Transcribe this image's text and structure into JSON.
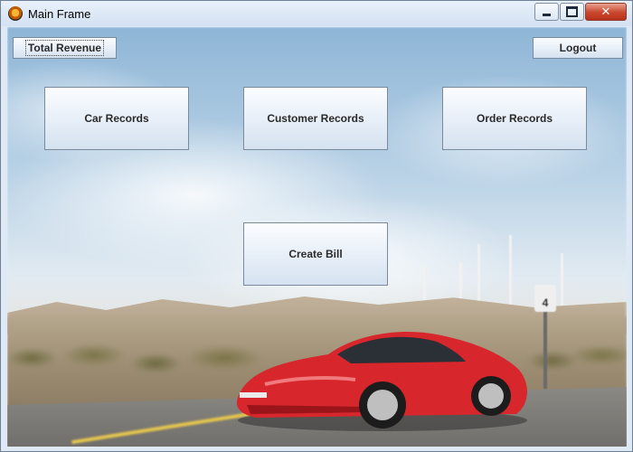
{
  "window": {
    "title": "Main Frame",
    "icon": "app-icon",
    "controls": {
      "minimize": "minimize-icon",
      "maximize": "maximize-icon",
      "close": "close-icon"
    }
  },
  "toolbar": {
    "total_revenue_label": "Total Revenue",
    "logout_label": "Logout"
  },
  "main": {
    "car_records_label": "Car Records",
    "customer_records_label": "Customer Records",
    "order_records_label": "Order Records",
    "create_bill_label": "Create Bill"
  },
  "background": {
    "scene": "red sports car on desert road with wind turbines",
    "sign_text": "4"
  },
  "colors": {
    "button_top": "#fbfdff",
    "button_bottom": "#d5e2f0",
    "button_border": "#7a8a9c",
    "car_red": "#d8262d"
  }
}
